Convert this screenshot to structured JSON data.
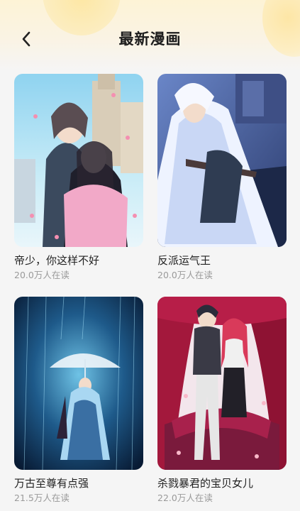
{
  "header": {
    "title": "最新漫画",
    "back_icon": "chevron-left-icon"
  },
  "comics": [
    {
      "title": "帝少，你这样不好",
      "readers": "20.0万人在读"
    },
    {
      "title": "反派运气王",
      "readers": "20.0万人在读"
    },
    {
      "title": "万古至尊有点强",
      "readers": "21.5万人在读"
    },
    {
      "title": "杀戮暴君的宝贝女儿",
      "readers": "22.0万人在读"
    }
  ],
  "colors": {
    "accent": "#fde7a4",
    "background": "#f5f5f5",
    "title_text": "#1c1c1c",
    "subtitle_text": "#9a9a9a"
  }
}
